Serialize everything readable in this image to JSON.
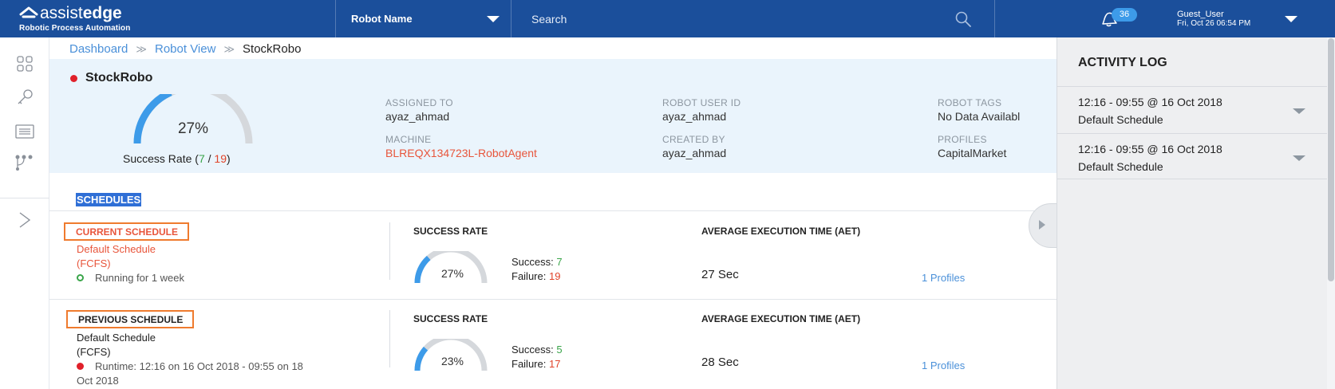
{
  "header": {
    "logo_text_light": "assist",
    "logo_text_bold": "edge",
    "logo_sub": "Robotic Process Automation",
    "robot_dropdown_label": "Robot Name",
    "search_placeholder": "Search",
    "notification_count": "36",
    "user_name": "Guest_User",
    "user_time": "Fri, Oct 26 06:54 PM"
  },
  "breadcrumb": {
    "items": [
      "Dashboard",
      "Robot View"
    ],
    "current": "StockRobo",
    "separator": "≫"
  },
  "robot": {
    "name": "StockRobo",
    "success_rate_percent": "27%",
    "success_rate_label": "Success Rate (",
    "success_count": "7",
    "slash": " / ",
    "total_count": "19",
    "close_paren": ")",
    "fields": {
      "assigned_to_label": "ASSIGNED TO",
      "assigned_to": "ayaz_ahmad",
      "machine_label": "MACHINE",
      "machine": "BLREQX134723L-RobotAgent",
      "robot_user_id_label": "ROBOT USER ID",
      "robot_user_id": "ayaz_ahmad",
      "created_by_label": "CREATED BY",
      "created_by": "ayaz_ahmad",
      "robot_tags_label": "ROBOT TAGS",
      "robot_tags": "No Data Availabl",
      "profiles_label": "PROFILES",
      "profiles": "CapitalMarket"
    }
  },
  "schedules": {
    "title": "SCHEDULES",
    "success_rate_head": "SUCCESS RATE",
    "aet_head": "AVERAGE EXECUTION TIME (AET)",
    "success_label": "Success:",
    "failure_label": "Failure:",
    "current": {
      "label": "CURRENT SCHEDULE",
      "name": "Default Schedule",
      "type": "(FCFS)",
      "status": "Running for 1 week",
      "rate": "27%",
      "rate_value": 0.27,
      "success": "7",
      "failure": "19",
      "aet": "27 Sec",
      "profiles": "1 Profiles"
    },
    "previous": {
      "label": "PREVIOUS SCHEDULE",
      "name": "Default Schedule",
      "type": "(FCFS)",
      "status_line1": "Runtime: 12:16 on 16 Oct 2018 - 09:55 on 18",
      "status_line2": "Oct 2018",
      "rate": "23%",
      "rate_value": 0.23,
      "success": "5",
      "failure": "17",
      "aet": "28 Sec",
      "profiles": "1 Profiles"
    }
  },
  "activity_log": {
    "title": "ACTIVITY LOG",
    "items": [
      {
        "time": "12:16 - 09:55 @ 16 Oct 2018",
        "name": "Default Schedule"
      },
      {
        "time": "12:16 - 09:55 @ 16 Oct 2018",
        "name": "Default Schedule"
      }
    ]
  },
  "colors": {
    "header_bg": "#1b4f9b",
    "accent_blue": "#4a90d9",
    "success_green": "#3aa54a",
    "failure_red": "#e0442a",
    "highlight_orange": "#ef7b2e",
    "summary_bg": "#eaf4fc"
  },
  "icons": {
    "logo": "assistedge-logo-icon",
    "search": "search-icon",
    "notification": "bell-icon",
    "nav": [
      "dashboard-grid-icon",
      "key-icon",
      "list-icon",
      "workflow-icon",
      "expand-chevron-icon"
    ]
  }
}
